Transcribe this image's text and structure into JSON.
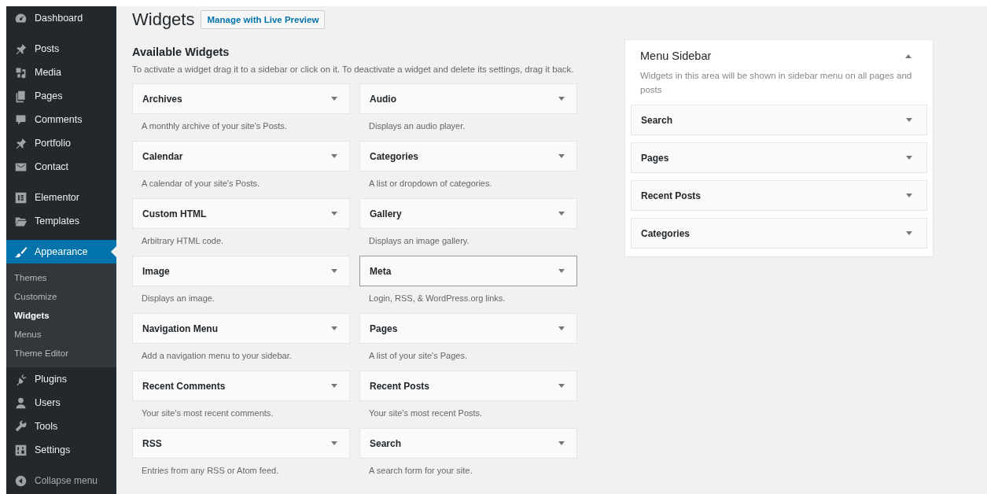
{
  "admin_menu": {
    "groups": [
      [
        {
          "label": "Dashboard",
          "selected": false
        }
      ],
      [
        {
          "label": "Posts",
          "selected": false
        },
        {
          "label": "Media",
          "selected": false
        },
        {
          "label": "Pages",
          "selected": false
        },
        {
          "label": "Comments",
          "selected": false
        },
        {
          "label": "Portfolio",
          "selected": false
        },
        {
          "label": "Contact",
          "selected": false
        }
      ],
      [
        {
          "label": "Elementor",
          "selected": false
        },
        {
          "label": "Templates",
          "selected": false
        }
      ],
      [
        {
          "label": "Appearance",
          "selected": true,
          "children": [
            {
              "label": "Themes",
              "selected": false
            },
            {
              "label": "Customize",
              "selected": false
            },
            {
              "label": "Widgets",
              "selected": true
            },
            {
              "label": "Menus",
              "selected": false
            },
            {
              "label": "Theme Editor",
              "selected": false
            }
          ]
        },
        {
          "label": "Plugins",
          "selected": false
        },
        {
          "label": "Users",
          "selected": false
        },
        {
          "label": "Tools",
          "selected": false
        },
        {
          "label": "Settings",
          "selected": false
        }
      ]
    ],
    "collapse": "Collapse menu"
  },
  "page": {
    "title": "Widgets",
    "action_button": "Manage with Live Preview"
  },
  "available": {
    "heading": "Available Widgets",
    "description": "To activate a widget drag it to a sidebar or click on it. To deactivate a widget and delete its settings, drag it back.",
    "widgets": [
      {
        "name": "Archives",
        "description": "A monthly archive of your site's Posts.",
        "focused": false
      },
      {
        "name": "Audio",
        "description": "Displays an audio player.",
        "focused": false
      },
      {
        "name": "Calendar",
        "description": "A calendar of your site's Posts.",
        "focused": false
      },
      {
        "name": "Categories",
        "description": "A list or dropdown of categories.",
        "focused": false
      },
      {
        "name": "Custom HTML",
        "description": "Arbitrary HTML code.",
        "focused": false
      },
      {
        "name": "Gallery",
        "description": "Displays an image gallery.",
        "focused": false
      },
      {
        "name": "Image",
        "description": "Displays an image.",
        "focused": false
      },
      {
        "name": "Meta",
        "description": "Login, RSS, & WordPress.org links.",
        "focused": true
      },
      {
        "name": "Navigation Menu",
        "description": "Add a navigation menu to your sidebar.",
        "focused": false
      },
      {
        "name": "Pages",
        "description": "A list of your site's Pages.",
        "focused": false
      },
      {
        "name": "Recent Comments",
        "description": "Your site's most recent comments.",
        "focused": false
      },
      {
        "name": "Recent Posts",
        "description": "Your site's most recent Posts.",
        "focused": false
      },
      {
        "name": "RSS",
        "description": "Entries from any RSS or Atom feed.",
        "focused": false
      },
      {
        "name": "Search",
        "description": "A search form for your site.",
        "focused": false
      }
    ]
  },
  "sidebar_area": {
    "title": "Menu Sidebar",
    "expanded": true,
    "description": "Widgets in this area will be shown in sidebar menu on all pages and posts",
    "widgets": [
      {
        "name": "Search"
      },
      {
        "name": "Pages"
      },
      {
        "name": "Recent Posts"
      },
      {
        "name": "Categories"
      }
    ]
  }
}
